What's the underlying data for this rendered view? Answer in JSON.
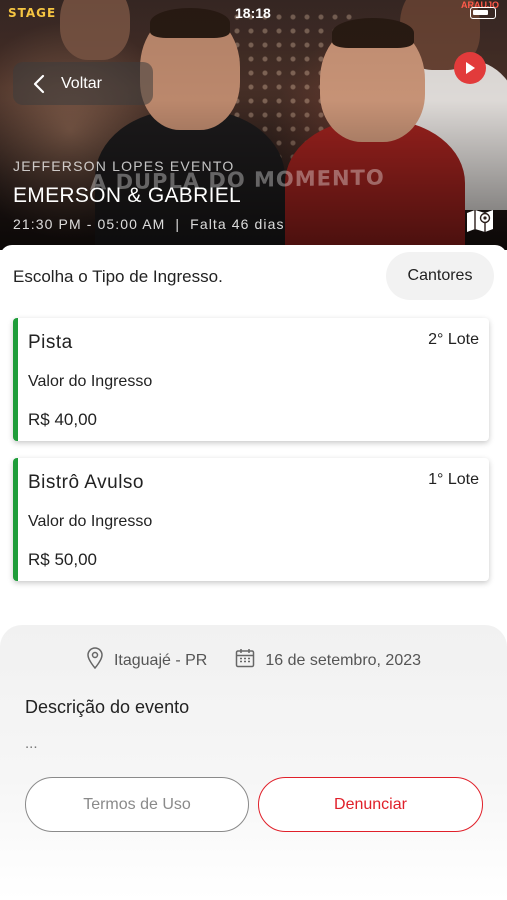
{
  "status_bar": {
    "time": "18:18"
  },
  "hero": {
    "brand_logo": "STAGE",
    "brand_corner": "ARAUJO",
    "promo_text": "A DUPLA DO MOMENTO",
    "back_label": "Voltar",
    "organizer": "JEFFERSON LOPES EVENTO",
    "title": "EMERSON & GABRIEL",
    "schedule": "21:30 PM - 05:00 AM",
    "separator": "|",
    "countdown": "Falta 46 dias"
  },
  "tickets_section": {
    "heading": "Escolha o Tipo de Ingresso.",
    "singers_button": "Cantores",
    "accent_color": "#1f9d3a",
    "items": [
      {
        "name": "Pista",
        "lot": "2° Lote",
        "label": "Valor do Ingresso",
        "price": "R$ 40,00"
      },
      {
        "name": "Bistrô Avulso",
        "lot": "1° Lote",
        "label": "Valor do Ingresso",
        "price": "R$ 50,00"
      }
    ]
  },
  "info": {
    "location": "Itaguajé - PR",
    "date": "16 de setembro, 2023",
    "description_title": "Descrição do evento",
    "description": "...",
    "terms_button": "Termos de Uso",
    "report_button": "Denunciar",
    "report_color": "#e0202a"
  },
  "icons": [
    "chevron-left-icon",
    "play-icon",
    "map-icon",
    "location-pin-icon",
    "calendar-icon"
  ]
}
